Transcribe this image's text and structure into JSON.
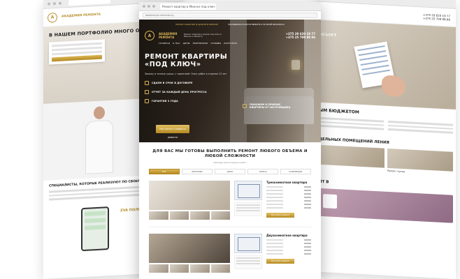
{
  "left": {
    "tab_label": "",
    "logo_letter": "А",
    "logo_text": "АКАДЕМИЯ РЕМОНТА",
    "portfolio_title": "В НАШЕМ ПОРТФОЛИО МНОГО ОБЪЕКТОВ",
    "form_button": "",
    "spec_title": "СПЕЦИАЛИСТЫ, КОТОРЫЕ РЕАЛИЗУЮТ ПО СВОЕМУ ПРОФИЛЮ",
    "viber_text": "ZVA ПОЛНЫЙ ОТЧ"
  },
  "right": {
    "phones": [
      "+375 29 620 19 77",
      "+375 25 709 98 86"
    ],
    "hero_label": "ОБЪЕКТ",
    "budget_title": "ЫМ БЮДЖЕТОМ",
    "budget_sub": "",
    "rooms_title": "ДЕЛЬНЫХ ПОМЕЩЕНИЙ ЛЕНИЯ",
    "room_caption": "Ремонт кухни",
    "bottom_title": "ИТ В"
  },
  "center": {
    "tab_label": "Ремонт квартир в Минске под ключ",
    "address": "akademiya-remonta.by",
    "top_strip": [
      "РЕМОНТ КВАРТИР И ДОМОВ В МИНСКЕ",
      "ОКАЗЫВАЕМ УСЛУГИ РЕМОНТА ПО ВСЕЙ БЕЛАРУСИ"
    ],
    "logo_letter": "А",
    "logo_text": "АКАДЕМИЯ РЕМОНТА",
    "nav_desc": "Ремонт квартир и домов под ключ в Минске и области",
    "phones": [
      "+375 29 620 19 77",
      "+375 25 709 98 86"
    ],
    "menu": [
      "ГЛАВНАЯ",
      "О НАС",
      "ЦЕНЫ",
      "ПОРТФОЛИО",
      "ОТЗЫВЫ",
      "КОНТАКТЫ"
    ],
    "hero_title": "РЕМОНТ КВАРТИРЫ «ПОД КЛЮЧ»",
    "hero_sub": "Закажу в точные сроки, с гарантией. Опыт работ в отделке 12 лет",
    "bullets": [
      "СДАЕМ В СРОК В ДОГОВОРЕ",
      "ОТЧЕТ ЗА КАЖДЫЙ ДЕНЬ ПРОГРЕССА",
      "ГАРАНТИЯ 3 ГОДА"
    ],
    "bullet_right": "ПОМОЖЕМ В ПРИЕМКЕ КВАРТИРЫ ОТ ЗАСТРОЙЩИКА",
    "hero_button": "Рассчитать стоимость ремонта",
    "section_title": "ДЛЯ ВАС МЫ ГОТОВЫ ВЫПОЛНИТЬ РЕМОНТ ЛЮБОГО ОБЪЕМА И ЛЮБОЙ СЛОЖНОСТИ",
    "section_sub": "Примеры выполненных работ",
    "tabs": [
      "ВСЕ",
      "КВАРТИРЫ",
      "ДОМА",
      "ОФИСЫ",
      "КОММЕРЦИЯ"
    ],
    "projects": [
      {
        "title": "Трехкомнатная квартира",
        "button": "Рассчитать ремонт"
      },
      {
        "title": "Двухкомнатная квартира",
        "button": "Рассчитать ремонт"
      }
    ]
  },
  "colors": {
    "gold": "#b58a22",
    "gold_light": "#d9b555",
    "dark": "#2a221b"
  }
}
